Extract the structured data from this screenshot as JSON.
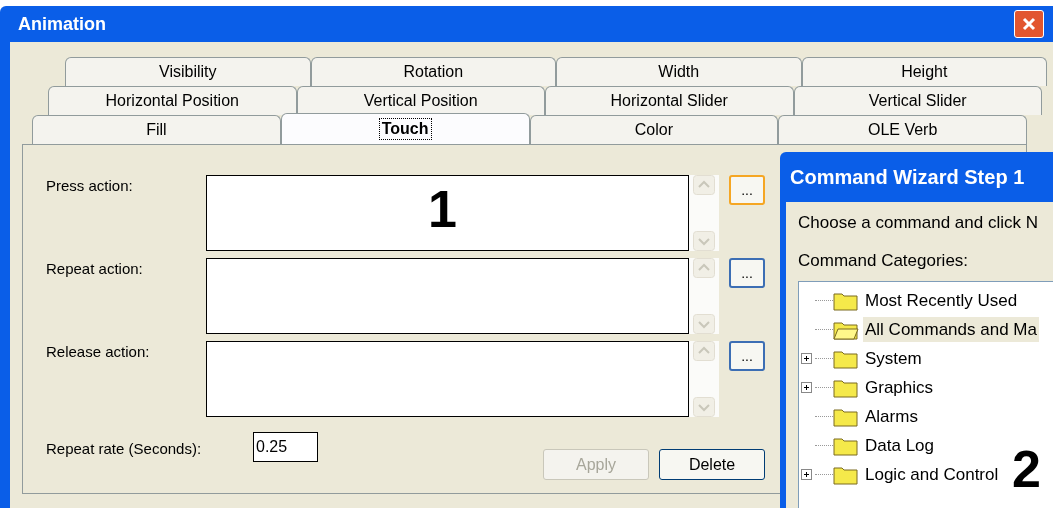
{
  "window": {
    "title": "Animation"
  },
  "tab_rows": [
    [
      {
        "label": "Visibility",
        "selected": false
      },
      {
        "label": "Rotation",
        "selected": false
      },
      {
        "label": "Width",
        "selected": false
      },
      {
        "label": "Height",
        "selected": false
      }
    ],
    [
      {
        "label": "Horizontal Position",
        "selected": false
      },
      {
        "label": "Vertical Position",
        "selected": false
      },
      {
        "label": "Horizontal Slider",
        "selected": false
      },
      {
        "label": "Vertical Slider",
        "selected": false
      }
    ],
    [
      {
        "label": "Fill",
        "selected": false
      },
      {
        "label": "Touch",
        "selected": true
      },
      {
        "label": "Color",
        "selected": false
      },
      {
        "label": "OLE Verb",
        "selected": false
      }
    ]
  ],
  "actions": [
    {
      "label": "Press action:",
      "focused": true,
      "browse": "..."
    },
    {
      "label": "Repeat action:",
      "focused": false,
      "browse": "..."
    },
    {
      "label": "Release action:",
      "focused": false,
      "browse": "..."
    }
  ],
  "repeat_rate": {
    "label": "Repeat rate (Seconds):",
    "value": "0.25"
  },
  "buttons": [
    {
      "label": "Apply",
      "disabled": true
    },
    {
      "label": "Delete",
      "disabled": false
    }
  ],
  "wizard": {
    "title": "Command Wizard Step 1",
    "instruction": "Choose a command and click N",
    "categories_label": "Command Categories:",
    "tree": [
      {
        "label": "Most Recently Used",
        "kind": "leaf",
        "selected": false
      },
      {
        "label": "All Commands and Ma",
        "kind": "leaf",
        "selected": true
      },
      {
        "label": "System",
        "kind": "group",
        "selected": false
      },
      {
        "label": "Graphics",
        "kind": "group",
        "selected": false
      },
      {
        "label": "Alarms",
        "kind": "leaf",
        "selected": false
      },
      {
        "label": "Data Log",
        "kind": "leaf",
        "selected": false
      },
      {
        "label": "Logic and Control",
        "kind": "group",
        "selected": false
      }
    ]
  },
  "annotations": [
    "1",
    "2"
  ]
}
